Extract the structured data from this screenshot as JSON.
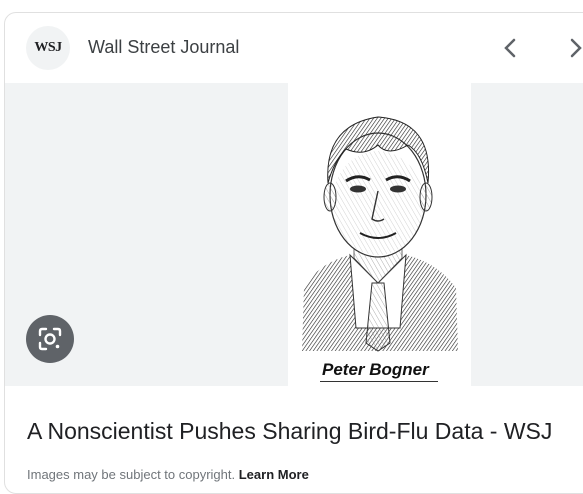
{
  "header": {
    "logo_text": "WSJ",
    "source_name": "Wall Street Journal"
  },
  "image": {
    "caption": "Peter Bogner"
  },
  "result": {
    "title": "A Nonscientist Pushes Sharing Bird-Flu Data - WSJ"
  },
  "footer": {
    "notice": "Images may be subject to copyright.",
    "learn_more": "Learn More"
  },
  "icons": {
    "prev": "chevron-left-icon",
    "next": "chevron-right-icon",
    "lens": "google-lens-icon"
  }
}
